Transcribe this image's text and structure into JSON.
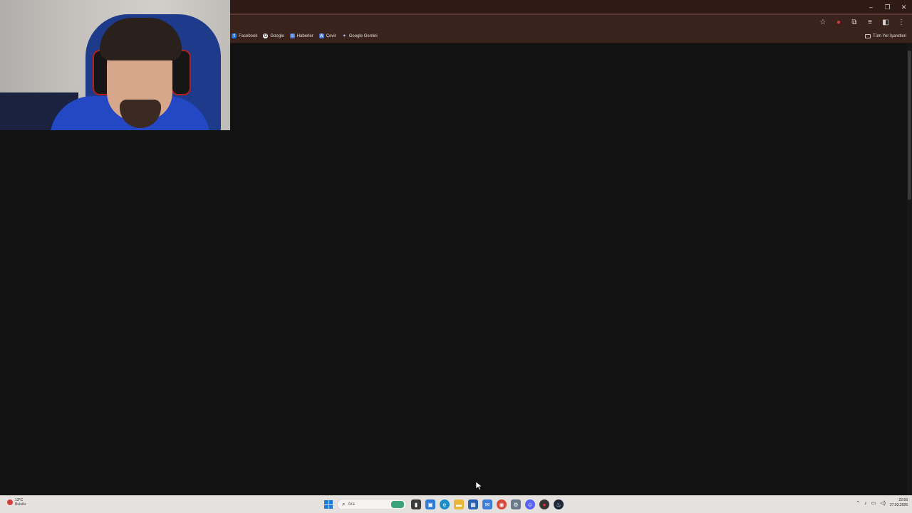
{
  "browser": {
    "window_controls": {
      "minimize": "–",
      "maximize": "❐",
      "close": "✕"
    },
    "toolbar_icons": [
      "star-icon",
      "extension-red-icon",
      "extensions-icon",
      "media-icon",
      "profile-icon",
      "menu-icon"
    ],
    "bookmarks": [
      {
        "label": "Facebook",
        "icon": "facebook-icon",
        "color": "#1877f2",
        "glyph": "f"
      },
      {
        "label": "Google",
        "icon": "google-icon",
        "color": "#ffffff",
        "glyph": "G"
      },
      {
        "label": "Haberler",
        "icon": "news-icon",
        "color": "#4a78d6",
        "glyph": "≡"
      },
      {
        "label": "Çevir",
        "icon": "translate-icon",
        "color": "#4a78d6",
        "glyph": "A"
      },
      {
        "label": "Google Gemini",
        "icon": "gemini-icon",
        "color": "#9aa9ff",
        "glyph": "✦"
      }
    ],
    "all_bookmarks_label": "Tüm Yer İşaretleri"
  },
  "taskbar": {
    "weather": {
      "temp": "13°C",
      "desc": "Bulutlu"
    },
    "search_placeholder": "Ara",
    "apps": [
      {
        "name": "file-explorer-icon",
        "color": "#3a3a3a",
        "glyph": "▮"
      },
      {
        "name": "photos-icon",
        "color": "#2d7bd6",
        "glyph": "▣"
      },
      {
        "name": "edge-icon",
        "color": "#1b8ec9",
        "glyph": "e"
      },
      {
        "name": "folder-icon",
        "color": "#e8b73a",
        "glyph": "▬"
      },
      {
        "name": "store-icon",
        "color": "#2b5fb0",
        "glyph": "▦"
      },
      {
        "name": "mail-icon",
        "color": "#3f7fd9",
        "glyph": "✉"
      },
      {
        "name": "chrome-icon",
        "color": "#d84a3a",
        "glyph": "◉"
      },
      {
        "name": "settings-icon",
        "color": "#6a7a8c",
        "glyph": "⚙"
      },
      {
        "name": "discord-icon",
        "color": "#5865f2",
        "glyph": "☺"
      },
      {
        "name": "app-red-icon",
        "color": "#333333",
        "glyph": "●"
      },
      {
        "name": "steam-icon",
        "color": "#1b2838",
        "glyph": "♨"
      }
    ],
    "tray": {
      "chevron": "^",
      "mic": "🎙",
      "network": "▭",
      "volume": "🔊"
    },
    "clock": {
      "time": "22:59",
      "date": "27.03.2026"
    }
  }
}
